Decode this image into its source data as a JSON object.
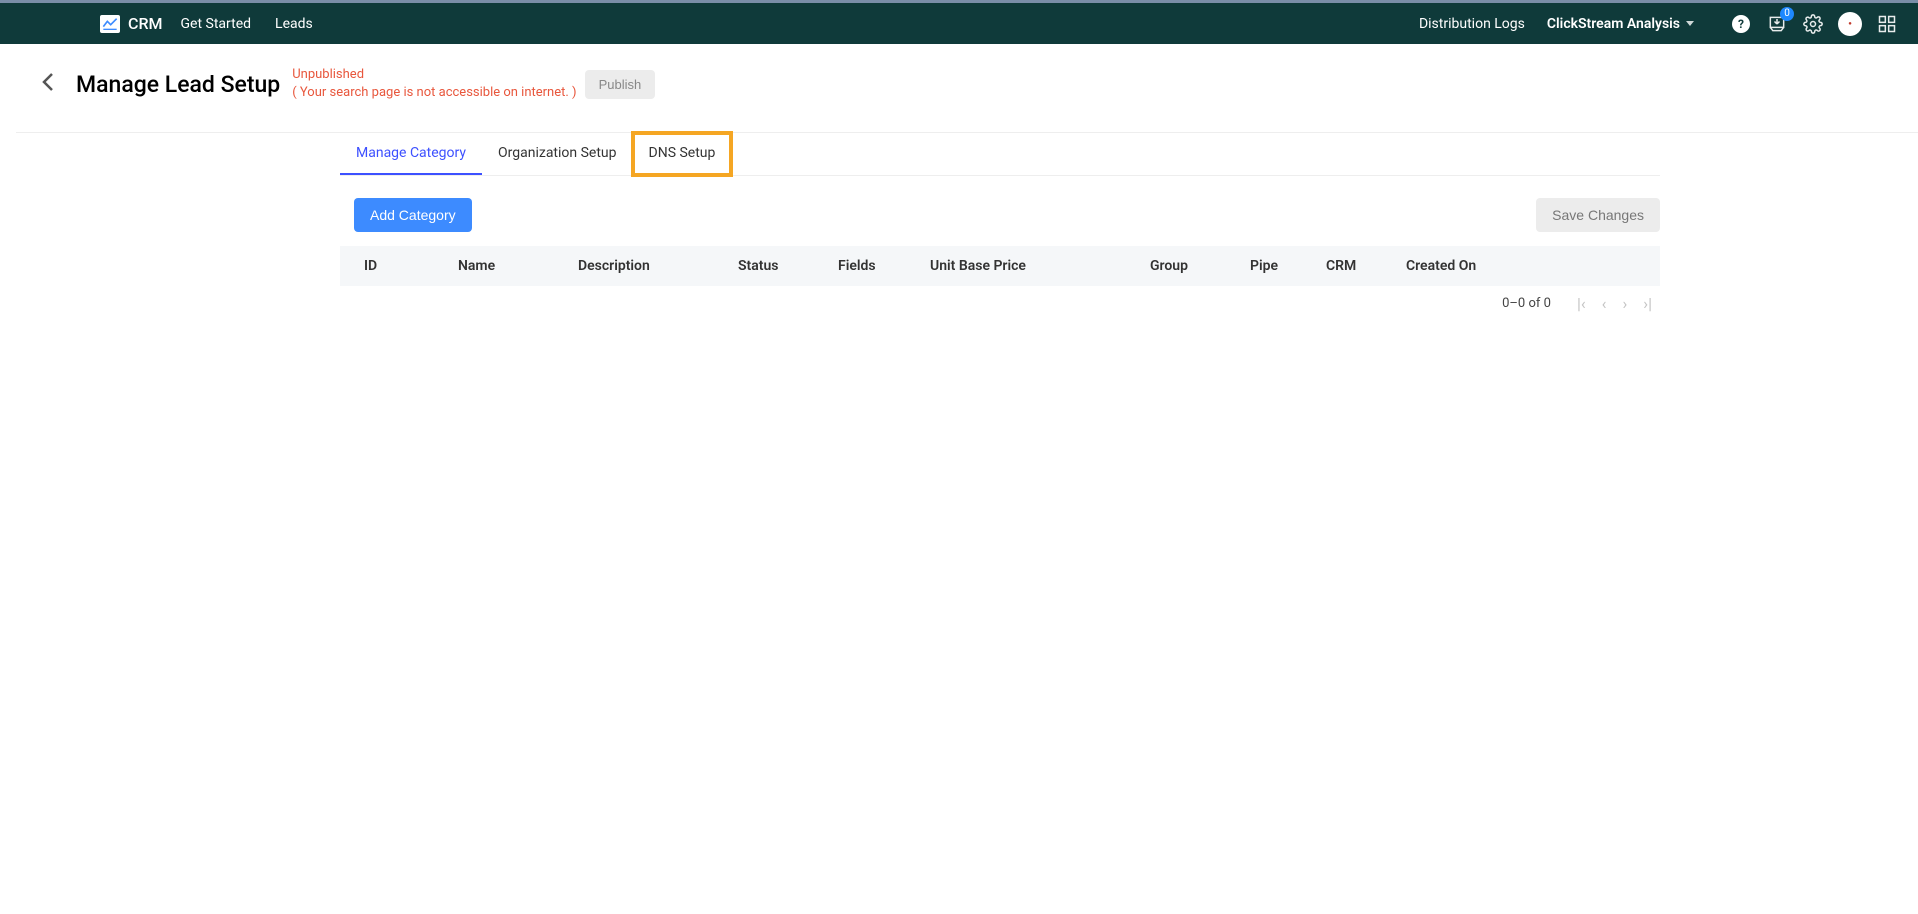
{
  "header": {
    "brand": "CRM",
    "nav": [
      "Get Started",
      "Leads"
    ],
    "right_links": [
      {
        "label": "Distribution Logs"
      },
      {
        "label": "ClickStream Analysis",
        "dropdown": true
      }
    ],
    "notification_count": "0"
  },
  "page": {
    "title": "Manage Lead Setup",
    "status_line1": "Unpublished",
    "status_line2": "( Your search page is not accessible on internet. )",
    "publish_label": "Publish"
  },
  "tabs": [
    {
      "label": "Manage Category",
      "active": true
    },
    {
      "label": "Organization Setup"
    },
    {
      "label": "DNS Setup",
      "highlight": true
    }
  ],
  "actions": {
    "add_label": "Add Category",
    "save_label": "Save Changes"
  },
  "columns": {
    "id": "ID",
    "name": "Name",
    "desc": "Description",
    "status": "Status",
    "fields": "Fields",
    "price": "Unit Base Price",
    "group": "Group",
    "pipe": "Pipe",
    "crm": "CRM",
    "created": "Created On"
  },
  "pager": {
    "range": "0–0 of 0"
  }
}
